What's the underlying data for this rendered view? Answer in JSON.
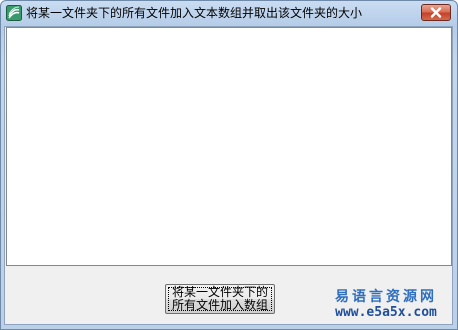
{
  "window": {
    "title": "将某一文件夹下的所有文件加入文本数组并取出该文件夹的大小",
    "app_icon": "app-window-icon",
    "close_icon": "close-icon"
  },
  "main": {
    "text_area_value": "",
    "button_label_line1": "将某一文件夹下的",
    "button_label_line2": "所有文件加入数组"
  },
  "watermark": {
    "site_name": "易语言资源网",
    "url": "www.e5a5x.com"
  },
  "colors": {
    "title_bar": "#c9dcf2",
    "close_button": "#c4432a",
    "client_bg": "#f0f0f0",
    "watermark_blue": "#2f6fbf"
  }
}
